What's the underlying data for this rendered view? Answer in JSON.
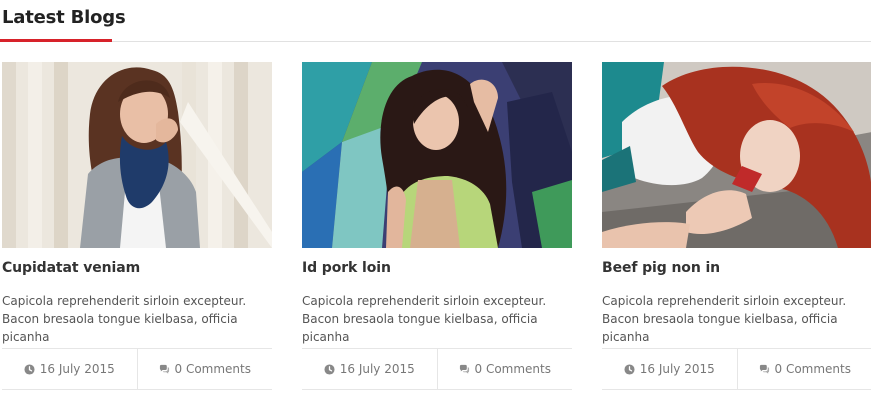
{
  "section": {
    "title": "Latest Blogs",
    "accent_color": "#d7222a"
  },
  "posts": [
    {
      "image": "woman-in-scarf-by-white-fence-photo",
      "title": "Cupidatat veniam",
      "excerpt": "Capicola reprehenderit sirloin excepteur. Bacon bresaola tongue kielbasa, officia picanha",
      "date": "16 July 2015",
      "comments": "0 Comments"
    },
    {
      "image": "woman-by-graffiti-wall-photo",
      "title": "Id pork loin",
      "excerpt": "Capicola reprehenderit sirloin excepteur. Bacon bresaola tongue kielbasa, officia picanha",
      "date": "16 July 2015",
      "comments": "0 Comments"
    },
    {
      "image": "red-haired-woman-lying-on-ground-photo",
      "title": "Beef pig non in",
      "excerpt": "Capicola reprehenderit sirloin excepteur. Bacon bresaola tongue kielbasa, officia picanha",
      "date": "16 July 2015",
      "comments": "0 Comments"
    }
  ],
  "icons": {
    "date": "clock-icon",
    "comments": "comments-icon"
  }
}
